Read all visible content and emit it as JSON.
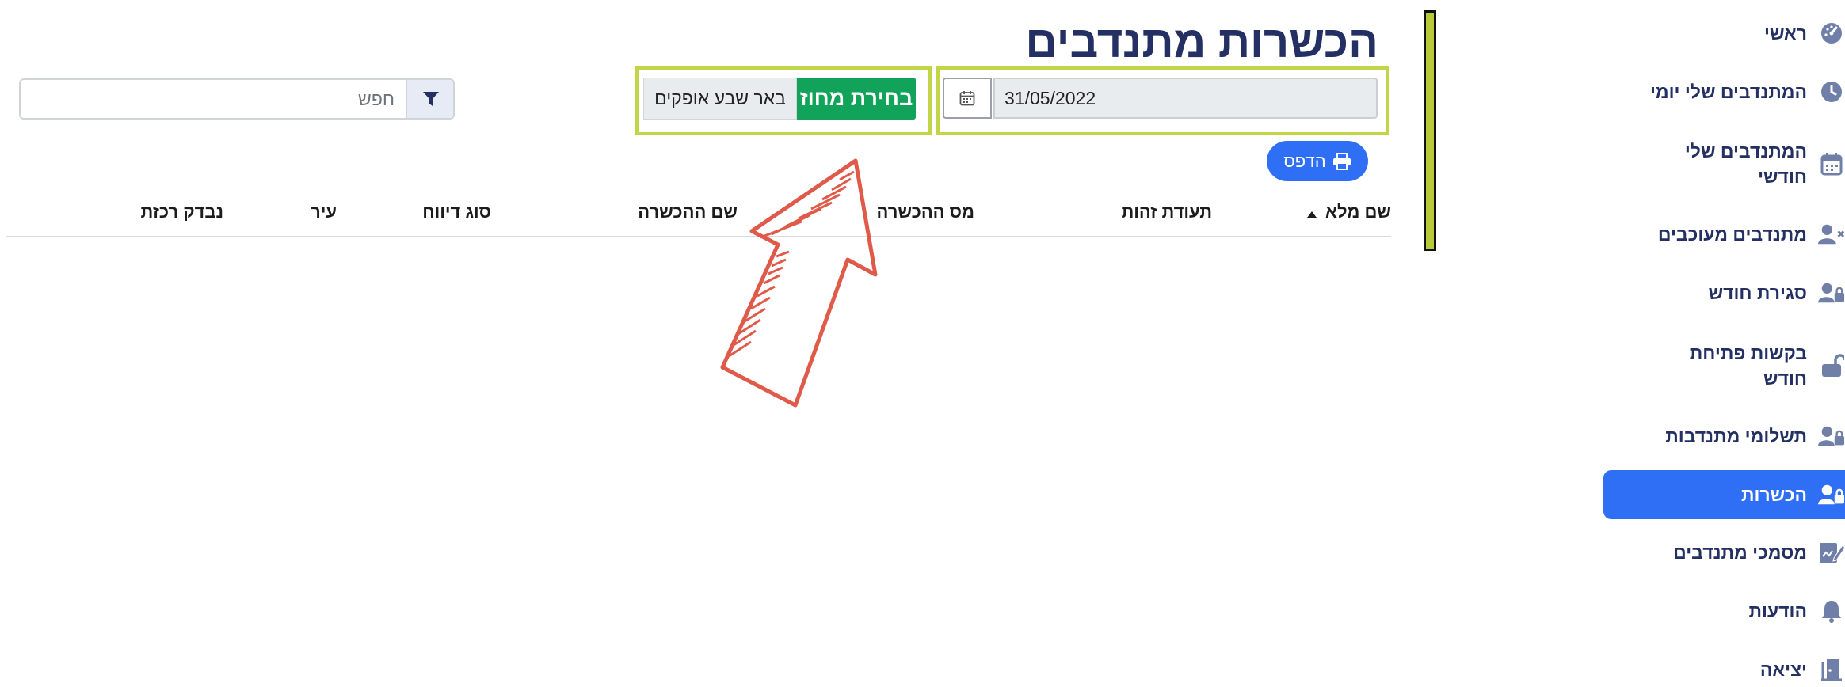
{
  "page": {
    "title": "הכשרות מתנדבים"
  },
  "filters": {
    "date_value": "31/05/2022",
    "district_button": "בחירת מחוז",
    "district_value": "באר שבע אופקים"
  },
  "print": {
    "label": "הדפס"
  },
  "search": {
    "placeholder": "חפש"
  },
  "table": {
    "headers": [
      "שם מלא",
      "תעודת זהות",
      "מס ההכשרה",
      "שם ההכשרה",
      "סוג דיווח",
      "עיר",
      "נבדק רכזת"
    ]
  },
  "sidebar": {
    "items": [
      {
        "label": "ראשי",
        "icon": "gauge-icon"
      },
      {
        "label": "המתנדבים שלי יומי",
        "icon": "clock-icon"
      },
      {
        "label": "המתנדבים שלי חודשי",
        "icon": "calendar-icon"
      },
      {
        "label": "מתנדבים מעוכבים",
        "icon": "user-x-icon"
      },
      {
        "label": "סגירת חודש",
        "icon": "user-lock-icon"
      },
      {
        "label": "בקשות פתיחת חודש",
        "icon": "unlock-icon"
      },
      {
        "label": "תשלומי מתנדבות",
        "icon": "user-lock-icon"
      },
      {
        "label": "הכשרות",
        "icon": "user-lock-icon",
        "active": true
      },
      {
        "label": "מסמכי מתנדבים",
        "icon": "document-pen-icon"
      },
      {
        "label": "הודעות",
        "icon": "bell-icon"
      },
      {
        "label": "יציאה",
        "icon": "door-exit-icon"
      }
    ]
  },
  "colors": {
    "accent_blue": "#2f6ff5",
    "navy_text": "#243063",
    "green_button": "#12a35a",
    "highlight_lime": "#c2d547",
    "annotation_red": "#e05a4a"
  }
}
